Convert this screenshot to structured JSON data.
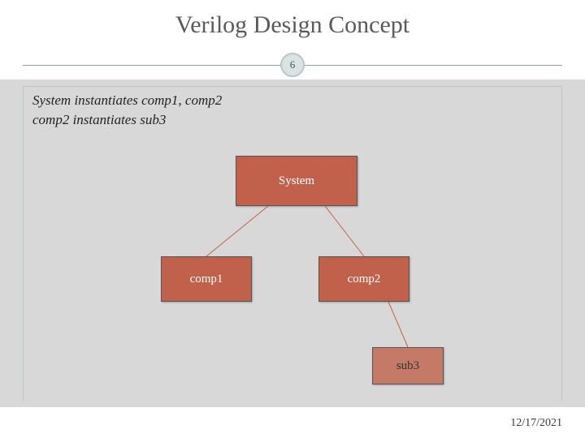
{
  "title": "Verilog Design Concept",
  "page_number": "6",
  "description": {
    "line1": "System instantiates comp1, comp2",
    "line2": "comp2 instantiates sub3"
  },
  "nodes": {
    "system": "System",
    "comp1": "comp1",
    "comp2": "comp2",
    "sub3": "sub3"
  },
  "footer_date": "12/17/2021",
  "colors": {
    "node_fill": "#c1614b",
    "panel_gray": "#d8d8d8",
    "rule_teal": "#8ca0a0"
  }
}
